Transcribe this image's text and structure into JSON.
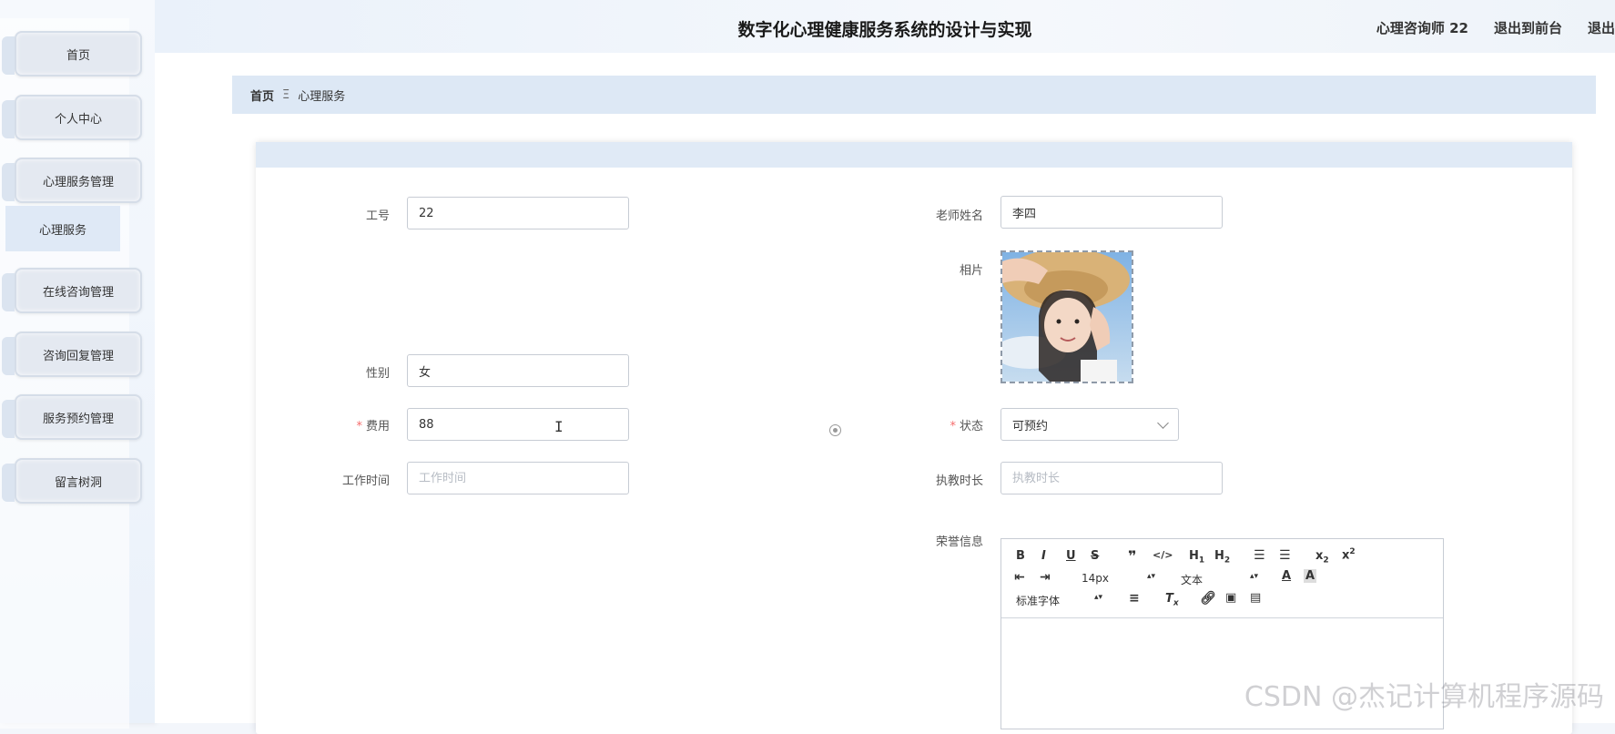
{
  "header": {
    "title": "数字化心理健康服务系统的设计与实现",
    "user": "心理咨询师 22",
    "exit_front": "退出到前台",
    "exit": "退出"
  },
  "sidebar": {
    "items": [
      {
        "label": "首页"
      },
      {
        "label": "个人中心"
      },
      {
        "label": "心理服务管理"
      },
      {
        "label": "在线咨询管理"
      },
      {
        "label": "咨询回复管理"
      },
      {
        "label": "服务预约管理"
      },
      {
        "label": "留言树洞"
      }
    ],
    "sub_item": "心理服务"
  },
  "breadcrumb": {
    "home": "首页",
    "separator": "Ξ",
    "current": "心理服务"
  },
  "form": {
    "job_no": {
      "label": "工号",
      "value": "22"
    },
    "teacher_name": {
      "label": "老师姓名",
      "value": "李四"
    },
    "photo": {
      "label": "相片"
    },
    "gender": {
      "label": "性别",
      "value": "女"
    },
    "fee": {
      "label": "费用",
      "value": "88",
      "required_mark": "*"
    },
    "status": {
      "label": "状态",
      "value": "可预约",
      "required_mark": "*"
    },
    "work_time": {
      "label": "工作时间",
      "placeholder": "工作时间"
    },
    "teaching_years": {
      "label": "执教时长",
      "placeholder": "执教时长"
    },
    "honors": {
      "label": "荣誉信息"
    }
  },
  "editor": {
    "font_size": "14px",
    "block_format": "文本",
    "font_family": "标准字体"
  },
  "watermark": "CSDN @杰记计算机程序源码"
}
